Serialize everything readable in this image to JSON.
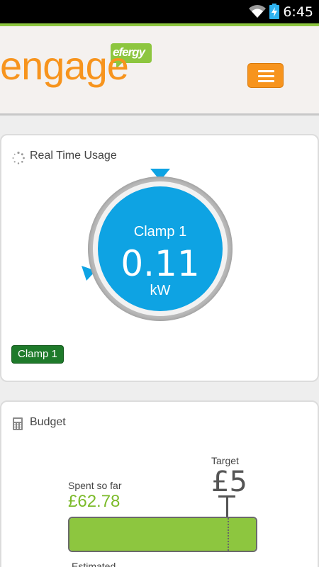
{
  "status_bar": {
    "time": "6:45",
    "icons": [
      "wifi-icon",
      "battery-charging-icon"
    ]
  },
  "header": {
    "logo_word": "engage",
    "logo_bubble": "efergy",
    "menu_icon": "hamburger-icon",
    "colors": {
      "brand_orange": "#f7941d",
      "brand_green": "#8dc63f"
    }
  },
  "realtime": {
    "title": "Real Time Usage",
    "gauge_label": "Clamp 1",
    "gauge_value": "0.11",
    "gauge_unit": "kW",
    "clamp_button": "Clamp 1",
    "accent": "#0ea3e3"
  },
  "budget": {
    "title": "Budget",
    "target_label": "Target",
    "target_value": "£5",
    "spent_label": "Spent so far",
    "spent_value": "£62.78",
    "estimated_label": "Estimated"
  }
}
